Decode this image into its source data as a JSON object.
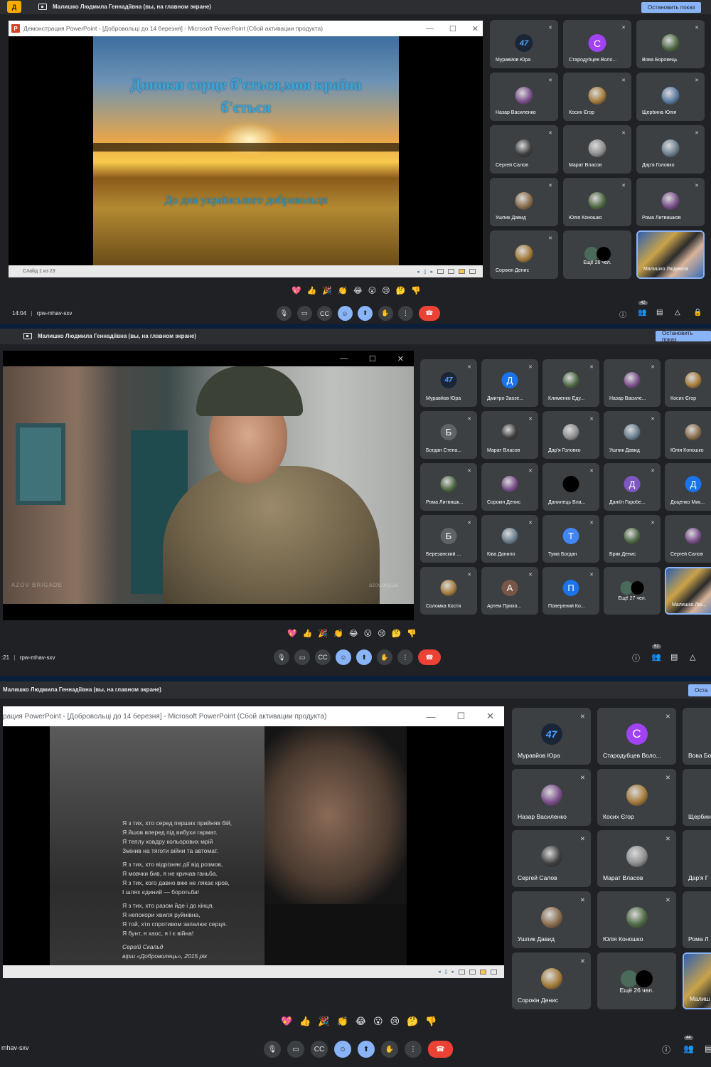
{
  "colors": {
    "meet_bg": "#202124",
    "tile_bg": "#3c4043",
    "accent": "#8ab4f8",
    "end_call": "#ea4335",
    "banner_badge": "#f9ab00"
  },
  "shot1": {
    "side_badge": "Д",
    "presenter_banner": "Малишко Людмила Геннадіївна (вы, на главном экране)",
    "stop_button": "Остановить показ",
    "window_title": "Демонстрация PowerPoint - [Добровольці до 14 березня] - Microsoft PowerPoint (Сбой активации продукта)",
    "slide_title": "Допоки серце б'ється,моя країна б'ється",
    "slide_subtitle": "До дня українського добровольця",
    "status_text": "Слайд 1 из 23",
    "participants": [
      {
        "name": "Муравйов Юра",
        "avatar": "logo"
      },
      {
        "name": "Стародубцев Воло...",
        "avatar": "C"
      },
      {
        "name": "Вова Боровець",
        "avatar": "photo"
      },
      {
        "name": "Назар Василенко",
        "avatar": "photo"
      },
      {
        "name": "Косих Єгор",
        "avatar": "photo"
      },
      {
        "name": "Щербина Юлія",
        "avatar": "photo"
      },
      {
        "name": "Сергей Салов",
        "avatar": "photo"
      },
      {
        "name": "Марат Власов",
        "avatar": "photo"
      },
      {
        "name": "Дар'я Головко",
        "avatar": "photo"
      },
      {
        "name": "Ушпик Давид",
        "avatar": "photo"
      },
      {
        "name": "Юлія Коношко",
        "avatar": "photo"
      },
      {
        "name": "Рома Литвишков",
        "avatar": "photo"
      },
      {
        "name": "Сорокін Денис",
        "avatar": "photo"
      },
      {
        "name": "Ещё 26 чел.",
        "avatar": "more"
      },
      {
        "name": "Малишко Людмила",
        "avatar": "self"
      }
    ],
    "time": "14:04",
    "meeting_code": "rpw-mhav-sxv",
    "people_count": "42"
  },
  "shot2": {
    "presenter_banner": "Малишко Людмила Геннадіївна (вы, на главном экране)",
    "stop_button": "Остановить показ",
    "watermark_left": "AZOV BRIGADE",
    "watermark_right": "azov.org.ua",
    "participants": [
      {
        "name": "Муравйов Юра",
        "avatar": "logo"
      },
      {
        "name": "Дмитро Заозе...",
        "avatar": "Д"
      },
      {
        "name": "Клименко Еду...",
        "avatar": "photo"
      },
      {
        "name": "Назар Василе...",
        "avatar": "photo"
      },
      {
        "name": "Косих Єгор",
        "avatar": "photo"
      },
      {
        "name": "Богдан Степа...",
        "avatar": "Б"
      },
      {
        "name": "Марат Власов",
        "avatar": "photo"
      },
      {
        "name": "Дар'я Головко",
        "avatar": "photo"
      },
      {
        "name": "Ушпик Давид",
        "avatar": "photo"
      },
      {
        "name": "Юлія Коношко",
        "avatar": "photo"
      },
      {
        "name": "Рома Литвишк...",
        "avatar": "photo"
      },
      {
        "name": "Сорокін Денис",
        "avatar": "photo"
      },
      {
        "name": "Данилець Вла...",
        "avatar": "black"
      },
      {
        "name": "Даніїл Горобе...",
        "avatar": "Д"
      },
      {
        "name": "Доценко Мик...",
        "avatar": "Д"
      },
      {
        "name": "Березанский ...",
        "avatar": "Б"
      },
      {
        "name": "Ківа Данило",
        "avatar": "photo"
      },
      {
        "name": "Тума Богдан",
        "avatar": "Т"
      },
      {
        "name": "Брик Денис",
        "avatar": "photo"
      },
      {
        "name": "Сергей Салов",
        "avatar": "photo"
      },
      {
        "name": "Соломка Костя",
        "avatar": "photo"
      },
      {
        "name": "Артем Прихо...",
        "avatar": "А"
      },
      {
        "name": "Поверений Ко...",
        "avatar": "П"
      },
      {
        "name": "Ещё 27 чел.",
        "avatar": "more"
      },
      {
        "name": "Малишко Лю...",
        "avatar": "self"
      }
    ],
    "time": ":21",
    "meeting_code": "rpw-mhav-sxv",
    "people_count": "52"
  },
  "shot3": {
    "presenter_banner": "Малишко Людмила Геннадіївна (вы, на главном экране)",
    "stop_button": "Оста",
    "window_title": "рация PowerPoint - [Добровольці до 14 березня] - Microsoft PowerPoint (Сбой активации продукта)",
    "poem": [
      "Я з тих, хто серед перших прийняв бій,",
      "Я йшов вперед під вибухи гармат.",
      "Я теплу ковдру кольорових мрій",
      "Змінив на тяготи війни та автомат.",
      "",
      "Я з тих, хто відрізняє дії від розмов,",
      "Я мовчки бив, я не кричав ганьба.",
      "Я з тих, кого давно вже не лякає кров,",
      "І шлях єдиний — боротьба!",
      "",
      "Я з тих, хто разом йде і до кінця,",
      "Я непокори хвиля руйнівна,",
      "Я той, хто спротивом запалює серця.",
      "Я бунт, я хаос, я і є війна!",
      "",
      "Сергій Скальд",
      "вірш «Доброволець», 2015 рік"
    ],
    "slide_logo": "УП",
    "participants": [
      {
        "name": "Муравйов Юра",
        "avatar": "logo"
      },
      {
        "name": "Стародубцев Воло...",
        "avatar": "C"
      },
      {
        "name": "Вова Бо",
        "avatar": "photo"
      },
      {
        "name": "Назар Василенко",
        "avatar": "photo"
      },
      {
        "name": "Косих Єгор",
        "avatar": "photo"
      },
      {
        "name": "Щербин",
        "avatar": "photo"
      },
      {
        "name": "Сергей Салов",
        "avatar": "photo"
      },
      {
        "name": "Марат Власов",
        "avatar": "photo"
      },
      {
        "name": "Дар'я Г",
        "avatar": "photo"
      },
      {
        "name": "Ушпик Давид",
        "avatar": "photo"
      },
      {
        "name": "Юлія Коношко",
        "avatar": "photo"
      },
      {
        "name": "Рома Л",
        "avatar": "photo"
      },
      {
        "name": "Сорокін Денис",
        "avatar": "photo"
      },
      {
        "name": "Ещё 26 чел.",
        "avatar": "more"
      },
      {
        "name": "Малиш",
        "avatar": "self"
      }
    ],
    "meeting_code": "mhav-sxv",
    "people_count": "44"
  },
  "reactions": [
    "💖",
    "👍",
    "🎉",
    "👏",
    "😂",
    "😮",
    "😢",
    "🤔",
    "👎"
  ],
  "icons": {
    "mic": "🎙",
    "camera": "▭",
    "captions": "CC",
    "emoji": "☺",
    "present": "⬆",
    "hand": "✋",
    "more": "⋮",
    "end": "☎",
    "info": "ⓘ",
    "people": "👥",
    "chat": "▤",
    "activities": "△",
    "lock": "🔒",
    "mic_off": "🔇"
  }
}
